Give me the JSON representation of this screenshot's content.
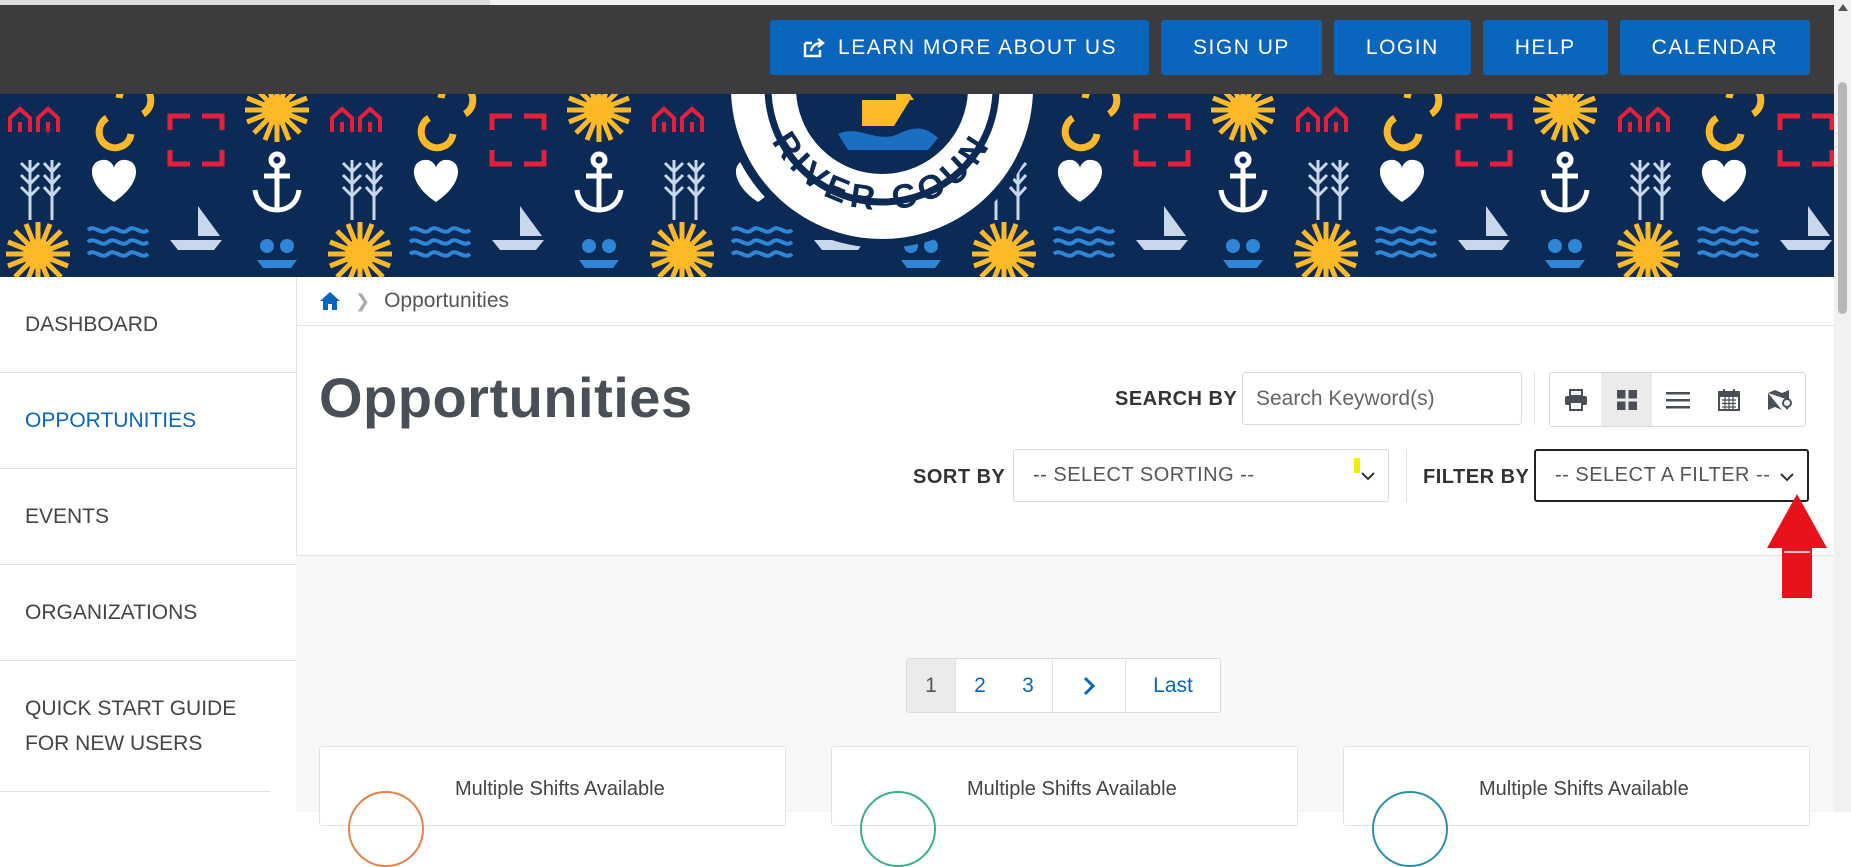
{
  "topnav": {
    "learn_more": "LEARN MORE ABOUT US",
    "sign_up": "SIGN UP",
    "login": "LOGIN",
    "help": "HELP",
    "calendar": "CALENDAR"
  },
  "banner": {
    "logo_text": "RIVER COUN"
  },
  "sidebar": {
    "items": [
      {
        "label": "DASHBOARD"
      },
      {
        "label": "OPPORTUNITIES"
      },
      {
        "label": "EVENTS"
      },
      {
        "label": "ORGANIZATIONS"
      },
      {
        "label": "QUICK START GUIDE FOR NEW USERS"
      }
    ]
  },
  "breadcrumb": {
    "current": "Opportunities"
  },
  "page": {
    "title": "Opportunities"
  },
  "search": {
    "label": "SEARCH BY",
    "placeholder": "Search Keyword(s)"
  },
  "sort": {
    "label": "SORT BY",
    "value": "-- SELECT SORTING --"
  },
  "filter": {
    "label": "FILTER BY",
    "value": "-- SELECT A FILTER --"
  },
  "view_tools": [
    "print-icon",
    "grid-view-icon",
    "list-view-icon",
    "calendar-view-icon",
    "map-view-icon"
  ],
  "pagination": {
    "pages": [
      "1",
      "2",
      "3"
    ],
    "last": "Last"
  },
  "cards": [
    {
      "title": "Multiple Shifts Available"
    },
    {
      "title": "Multiple Shifts Available"
    },
    {
      "title": "Multiple Shifts Available"
    }
  ],
  "colors": {
    "primary": "#0a66bc",
    "topbar": "#3c3b3d",
    "banner_bg": "#0b2a55",
    "banner_yellow": "#fdb927",
    "banner_red": "#e4203a",
    "annotation_arrow": "#e8121c"
  }
}
